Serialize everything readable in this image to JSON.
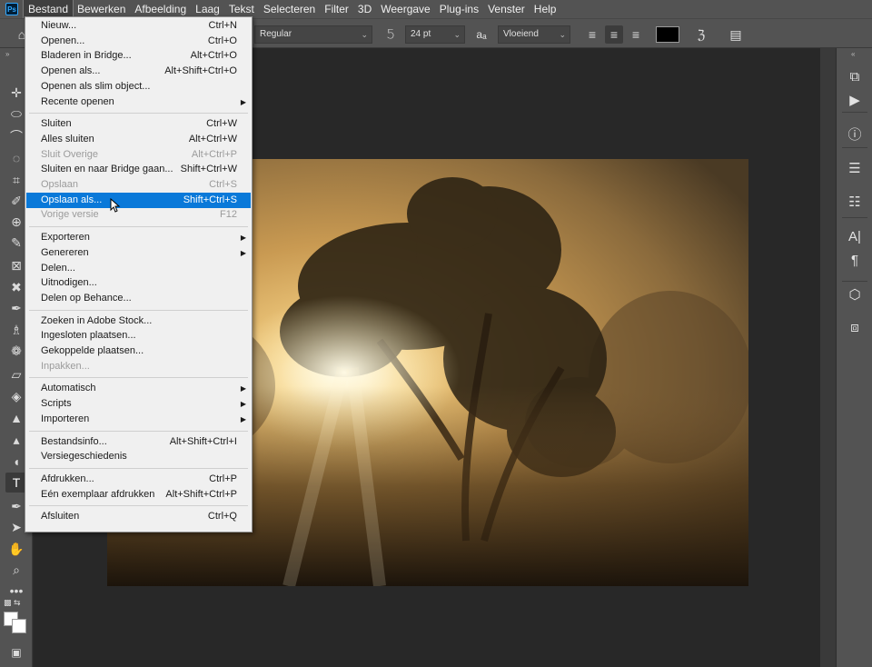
{
  "app": {
    "logo": "Ps"
  },
  "menubar": {
    "items": [
      "Bestand",
      "Bewerken",
      "Afbeelding",
      "Laag",
      "Tekst",
      "Selecteren",
      "Filter",
      "3D",
      "Weergave",
      "Plug-ins",
      "Venster",
      "Help"
    ],
    "active": "Bestand"
  },
  "options": {
    "font_style": "Regular",
    "font_size": "24 pt",
    "antialias_label": "aₐ",
    "antialias": "Vloeiend",
    "text_color": "#000000"
  },
  "file_menu": {
    "groups": [
      [
        {
          "label": "Nieuw...",
          "shortcut": "Ctrl+N"
        },
        {
          "label": "Openen...",
          "shortcut": "Ctrl+O"
        },
        {
          "label": "Bladeren in Bridge...",
          "shortcut": "Alt+Ctrl+O"
        },
        {
          "label": "Openen als...",
          "shortcut": "Alt+Shift+Ctrl+O"
        },
        {
          "label": "Openen als slim object...",
          "shortcut": ""
        },
        {
          "label": "Recente openen",
          "shortcut": "",
          "submenu": true
        }
      ],
      [
        {
          "label": "Sluiten",
          "shortcut": "Ctrl+W"
        },
        {
          "label": "Alles sluiten",
          "shortcut": "Alt+Ctrl+W"
        },
        {
          "label": "Sluit Overige",
          "shortcut": "Alt+Ctrl+P",
          "disabled": true
        },
        {
          "label": "Sluiten en naar Bridge gaan...",
          "shortcut": "Shift+Ctrl+W"
        },
        {
          "label": "Opslaan",
          "shortcut": "Ctrl+S",
          "disabled": true
        },
        {
          "label": "Opslaan als...",
          "shortcut": "Shift+Ctrl+S",
          "highlighted": true
        },
        {
          "label": "Vorige versie",
          "shortcut": "F12",
          "disabled": true
        }
      ],
      [
        {
          "label": "Exporteren",
          "shortcut": "",
          "submenu": true
        },
        {
          "label": "Genereren",
          "shortcut": "",
          "submenu": true
        },
        {
          "label": "Delen...",
          "shortcut": ""
        },
        {
          "label": "Uitnodigen...",
          "shortcut": ""
        },
        {
          "label": "Delen op Behance...",
          "shortcut": ""
        }
      ],
      [
        {
          "label": "Zoeken in Adobe Stock...",
          "shortcut": ""
        },
        {
          "label": "Ingesloten plaatsen...",
          "shortcut": ""
        },
        {
          "label": "Gekoppelde plaatsen...",
          "shortcut": ""
        },
        {
          "label": "Inpakken...",
          "shortcut": "",
          "disabled": true
        }
      ],
      [
        {
          "label": "Automatisch",
          "shortcut": "",
          "submenu": true
        },
        {
          "label": "Scripts",
          "shortcut": "",
          "submenu": true
        },
        {
          "label": "Importeren",
          "shortcut": "",
          "submenu": true
        }
      ],
      [
        {
          "label": "Bestandsinfo...",
          "shortcut": "Alt+Shift+Ctrl+I"
        },
        {
          "label": "Versiegeschiedenis",
          "shortcut": ""
        }
      ],
      [
        {
          "label": "Afdrukken...",
          "shortcut": "Ctrl+P"
        },
        {
          "label": "Eén exemplaar afdrukken",
          "shortcut": "Alt+Shift+Ctrl+P"
        }
      ],
      [
        {
          "label": "Afsluiten",
          "shortcut": "Ctrl+Q"
        }
      ]
    ]
  },
  "tools": [
    {
      "name": "move-tool-icon",
      "glyph": "✛"
    },
    {
      "name": "marquee-tool-icon",
      "glyph": "⬭"
    },
    {
      "name": "lasso-tool-icon",
      "glyph": "⌒"
    },
    {
      "name": "quick-select-tool-icon",
      "glyph": "◌"
    },
    {
      "name": "crop-tool-icon",
      "glyph": "⌗"
    },
    {
      "name": "eyedropper-tool-icon",
      "glyph": "✐"
    },
    {
      "name": "healing-brush-tool-icon",
      "glyph": "⊕"
    },
    {
      "name": "brush-tool-icon",
      "glyph": "✎"
    },
    {
      "name": "frame-tool-icon",
      "glyph": "⊠"
    },
    {
      "name": "clone-stamp-tool-icon",
      "glyph": "✖"
    },
    {
      "name": "history-brush-tool-icon",
      "glyph": "✒"
    },
    {
      "name": "stamp-tool-icon",
      "glyph": "♗"
    },
    {
      "name": "art-history-tool-icon",
      "glyph": "❁"
    },
    {
      "name": "eraser-tool-icon",
      "glyph": "▱"
    },
    {
      "name": "paint-bucket-tool-icon",
      "glyph": "◈"
    },
    {
      "name": "blur-tool-icon",
      "glyph": "▲"
    },
    {
      "name": "sharpen-tool-icon",
      "glyph": "▴"
    },
    {
      "name": "dodge-tool-icon",
      "glyph": "◖"
    },
    {
      "name": "type-tool-icon",
      "glyph": "T",
      "selected": true
    },
    {
      "name": "pen-tool-icon",
      "glyph": "✒"
    },
    {
      "name": "path-select-tool-icon",
      "glyph": "➤"
    },
    {
      "name": "hand-tool-icon",
      "glyph": "✋"
    },
    {
      "name": "zoom-tool-icon",
      "glyph": "⌕"
    },
    {
      "name": "more-tools-icon",
      "glyph": "•••"
    }
  ],
  "right_panel": [
    {
      "name": "history-panel-icon",
      "glyph": "⧉"
    },
    {
      "name": "actions-play-icon",
      "glyph": "▶"
    },
    {
      "name": "info-panel-icon",
      "glyph": "ⓘ"
    },
    {
      "name": "properties-panel-icon",
      "glyph": "☰"
    },
    {
      "name": "adjustments-panel-icon",
      "glyph": "☷"
    },
    {
      "name": "character-panel-icon",
      "glyph": "A|"
    },
    {
      "name": "paragraph-panel-icon",
      "glyph": "¶"
    },
    {
      "name": "3d-panel-icon",
      "glyph": "⬡"
    },
    {
      "name": "layers-panel-icon",
      "glyph": "⧈"
    }
  ]
}
